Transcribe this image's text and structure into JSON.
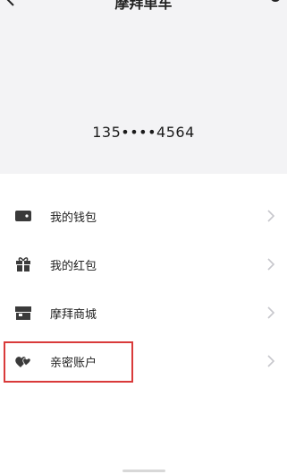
{
  "header": {
    "title": "摩拜单车",
    "phone": "135••••4564"
  },
  "menu": [
    {
      "label": "我的钱包",
      "icon": "wallet-icon"
    },
    {
      "label": "我的红包",
      "icon": "gift-icon"
    },
    {
      "label": "摩拜商城",
      "icon": "store-icon"
    },
    {
      "label": "亲密账户",
      "icon": "hearts-icon"
    }
  ],
  "colors": {
    "header_bg": "#f3f3f5",
    "highlight": "#d93a3a",
    "icon": "#3a3a3a",
    "chevron": "#c7c7cc"
  }
}
